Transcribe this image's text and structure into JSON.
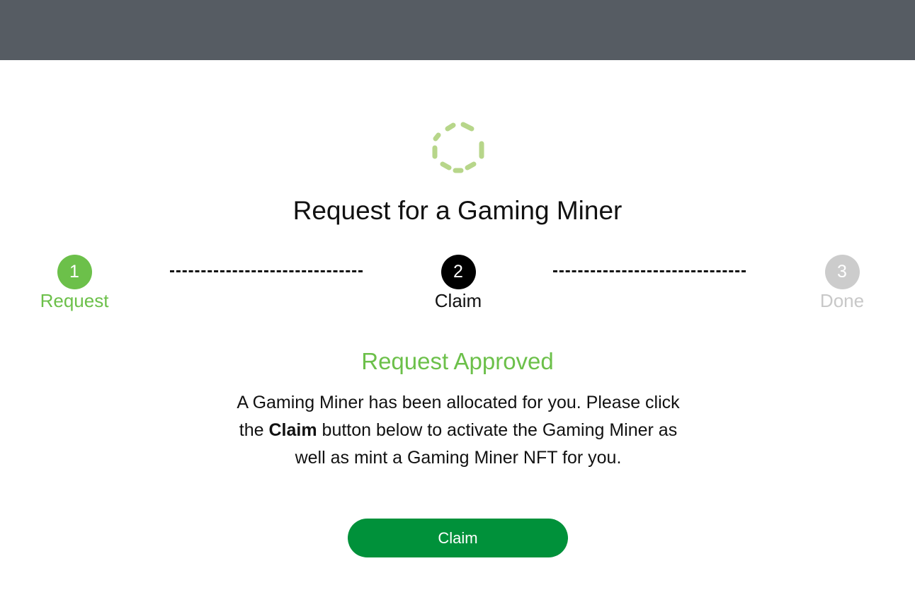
{
  "header": {
    "background_color": "#565c63"
  },
  "loading_icon": {
    "name": "hexagon-spinner-icon",
    "color": "#b7d68a"
  },
  "page": {
    "title": "Request for a Gaming Miner"
  },
  "stepper": {
    "steps": [
      {
        "number": "1",
        "label": "Request",
        "state": "completed",
        "color": "#6cc04a"
      },
      {
        "number": "2",
        "label": "Claim",
        "state": "active",
        "color": "#000000"
      },
      {
        "number": "3",
        "label": "Done",
        "state": "pending",
        "color": "#cccccc"
      }
    ]
  },
  "status": {
    "title": "Request Approved",
    "color": "#6cc04a"
  },
  "message": {
    "part1": "A Gaming Miner has been allocated for you. Please click the ",
    "emphasis": "Claim",
    "part2": " button below to activate the Gaming Miner as well as mint a Gaming Miner NFT for you."
  },
  "actions": {
    "claim_label": "Claim",
    "claim_color": "#00913a"
  }
}
